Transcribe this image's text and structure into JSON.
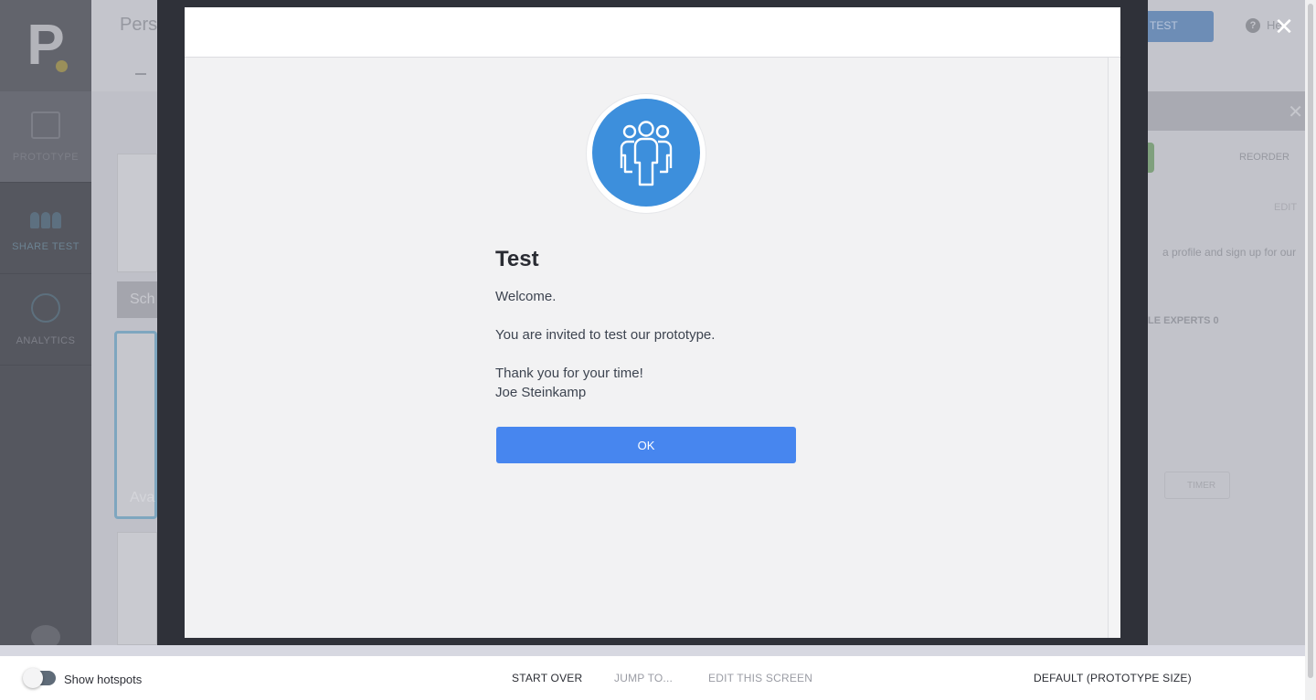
{
  "background_app": {
    "logo_letter": "P",
    "sidebar": {
      "items": [
        {
          "label": "PROTOTYPE",
          "icon": "prototype-icon"
        },
        {
          "label": "SHARE TEST",
          "icon": "people-icon"
        },
        {
          "label": "ANALYTICS",
          "icon": "analytics-icon"
        }
      ]
    },
    "title": "Pers",
    "test_button": "TEST",
    "help_label": "He",
    "panel": {
      "reorder": "REORDER",
      "edit": "EDIT",
      "text": "a profile and sign up for our",
      "experts": "LE EXPERTS 0",
      "timer": "TIMER"
    },
    "screens": {
      "dark_label": "Sch",
      "selected_label": "Ava"
    }
  },
  "viewer": {
    "close_icon": "close-icon",
    "welcome": {
      "avatar_icon": "team-icon",
      "avatar_color": "#3d8fdc",
      "title": "Test",
      "line1": "Welcome.",
      "line2": "You are invited to test our prototype.",
      "line3": "Thank you for your time!",
      "line4": "Joe Steinkamp",
      "ok_label": "OK",
      "ok_color": "#4786ef"
    }
  },
  "toolbar": {
    "toggle_label": "Show hotspots",
    "toggle_on": false,
    "start_over": "START OVER",
    "jump_to": "JUMP TO...",
    "edit_screen": "EDIT THIS SCREEN",
    "size_select": "DEFAULT (PROTOTYPE SIZE)"
  }
}
